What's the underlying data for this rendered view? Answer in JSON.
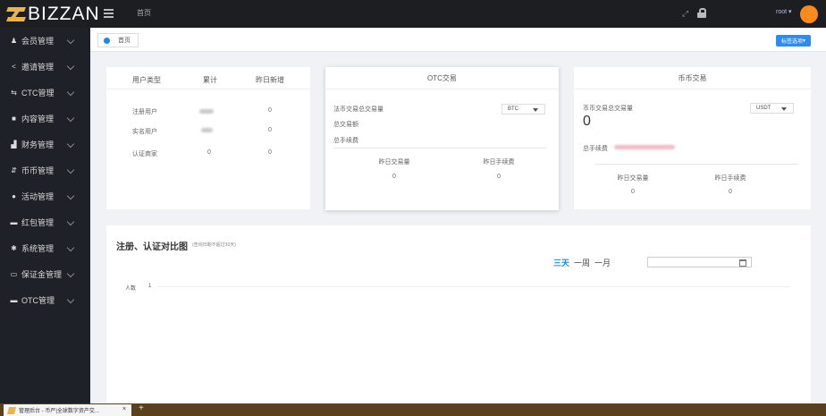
{
  "brand": {
    "logo_text": "BIZZAN",
    "accent": "#e7b54a"
  },
  "topbar": {
    "home": "首页",
    "user": "root",
    "avatar_color": "#ff8a1a"
  },
  "sidebar": {
    "items": [
      {
        "label": "会员管理",
        "icon": "users-icon"
      },
      {
        "label": "邀请管理",
        "icon": "share-icon"
      },
      {
        "label": "CTC管理",
        "icon": "exchange-icon"
      },
      {
        "label": "内容管理",
        "icon": "content-icon"
      },
      {
        "label": "财务管理",
        "icon": "chart-icon"
      },
      {
        "label": "币币管理",
        "icon": "coin-icon"
      },
      {
        "label": "活动管理",
        "icon": "activity-icon"
      },
      {
        "label": "红包管理",
        "icon": "redpacket-icon"
      },
      {
        "label": "系统管理",
        "icon": "gear-icon"
      },
      {
        "label": "保证金管理",
        "icon": "card-icon"
      },
      {
        "label": "OTC管理",
        "icon": "otc-icon"
      }
    ]
  },
  "tabs": {
    "home": "首页",
    "actions": "标签选项"
  },
  "user_card": {
    "headers": [
      "用户类型",
      "累计",
      "昨日新增"
    ],
    "rows": [
      {
        "type": "注册用户",
        "total": "",
        "yesterday": "0"
      },
      {
        "type": "实名用户",
        "total": "",
        "yesterday": "0"
      },
      {
        "type": "认证商家",
        "total": "0",
        "yesterday": "0"
      }
    ]
  },
  "otc_card": {
    "title": "OTC交易",
    "labels": [
      "法币交易总交易量",
      "总交易额",
      "总手续费"
    ],
    "currency": "BTC",
    "yesterday_volume_label": "昨日交易量",
    "yesterday_fee_label": "昨日手续费",
    "yesterday_volume": "0",
    "yesterday_fee": "0"
  },
  "coin_card": {
    "title": "币币交易",
    "volume_label": "币币交易总交易量",
    "volume_value": "0",
    "currency": "USDT",
    "fee_label": "总手续费",
    "yesterday_volume_label": "昨日交易量",
    "yesterday_fee_label": "昨日手续费",
    "yesterday_volume": "0",
    "yesterday_fee": "0"
  },
  "chart_panel": {
    "title": "注册、认证对比图",
    "note": "(查询日期不超过30天)",
    "ranges": [
      "三天",
      "一周",
      "一月"
    ],
    "active_range": "三天",
    "y_axis_label": "人数",
    "y_tick": "1"
  },
  "taskbar": {
    "tab_title": "管理后台 - 币严|全球数字资产交...",
    "close": "×",
    "new_tab": "+"
  }
}
